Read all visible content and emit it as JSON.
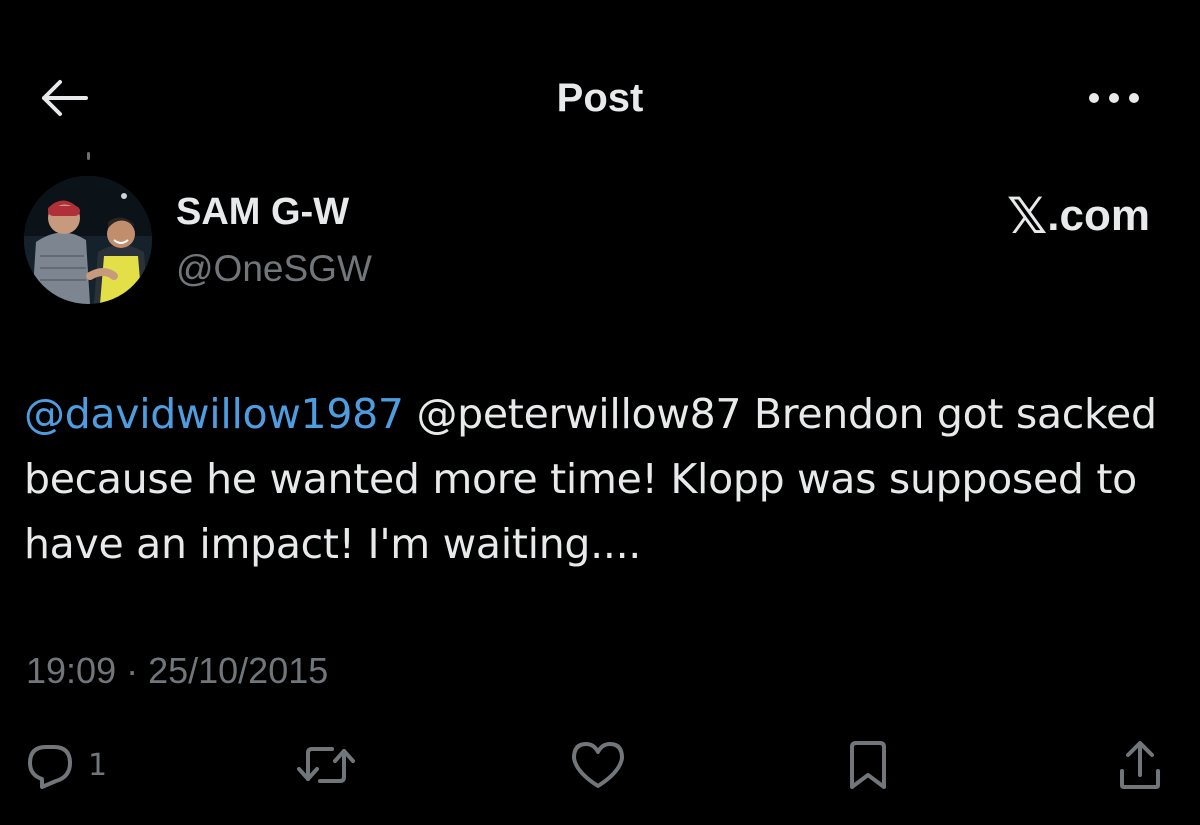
{
  "header": {
    "title": "Post",
    "back_icon": "arrow-left-icon",
    "more_icon": "more-horizontal-icon"
  },
  "author": {
    "display_name": "SAM G-W",
    "handle": "@OneSGW"
  },
  "brand": {
    "mark": "𝕏",
    "domain": ".com"
  },
  "post": {
    "mention_1": "@davidwillow1987",
    "mention_2": "@peterwillow87",
    "text": " Brendon got sacked because he wanted more time! Klopp was supposed to have an impact! I'm waiting....",
    "timestamp": "19:09 · 25/10/2015"
  },
  "actions": {
    "reply_count": "1",
    "icons": [
      "reply-icon",
      "repost-icon",
      "like-icon",
      "bookmark-icon",
      "share-icon"
    ]
  },
  "colors": {
    "background": "#000000",
    "text": "#e7e9ea",
    "secondary": "#71767b",
    "link": "#4d9de0"
  }
}
